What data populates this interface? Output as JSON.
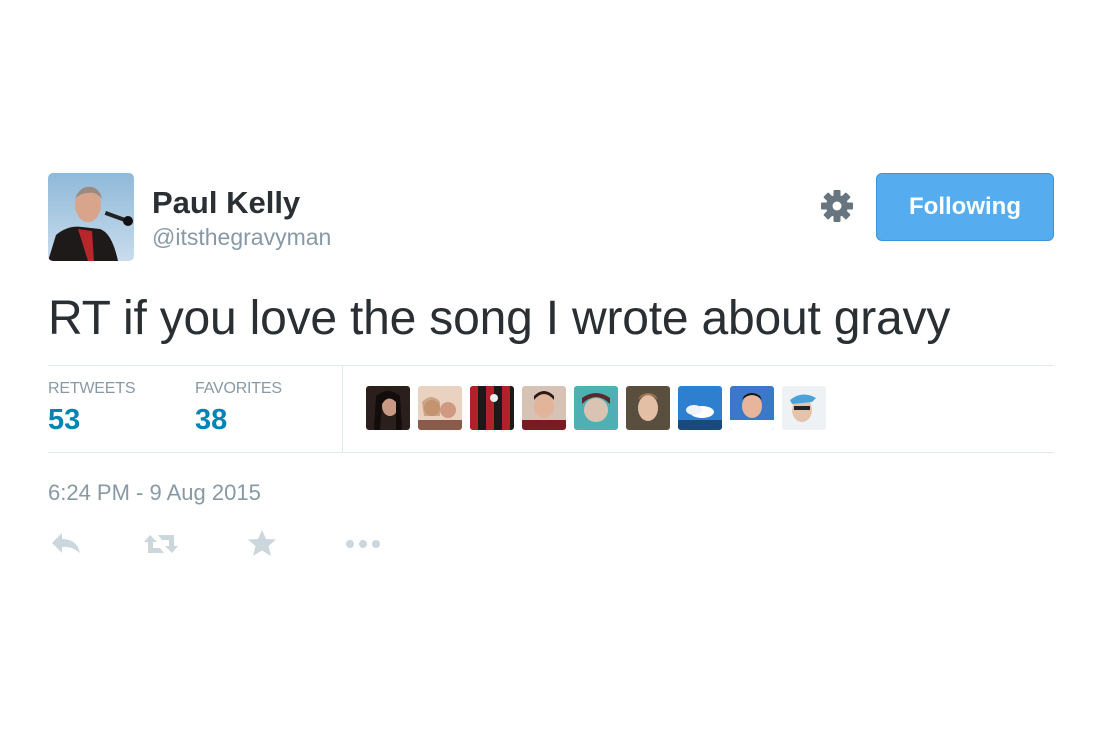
{
  "user": {
    "name": "Paul Kelly",
    "handle": "@itsthegravyman"
  },
  "follow_button": {
    "label": "Following"
  },
  "tweet": {
    "text": "RT if you love the song I wrote about gravy",
    "timestamp": "6:24 PM - 9 Aug 2015"
  },
  "stats": {
    "retweets_label": "RETWEETS",
    "retweets_count": "53",
    "favorites_label": "FAVORITES",
    "favorites_count": "38"
  },
  "colors": {
    "follow_button": "#55acee",
    "stat_value": "#0084b4",
    "muted_text": "#8899a6",
    "action_icon": "#ccd6dd"
  },
  "icons": {
    "settings": "gear-icon",
    "reply": "reply-icon",
    "retweet": "retweet-icon",
    "favorite": "star-icon",
    "more": "more-icon"
  }
}
